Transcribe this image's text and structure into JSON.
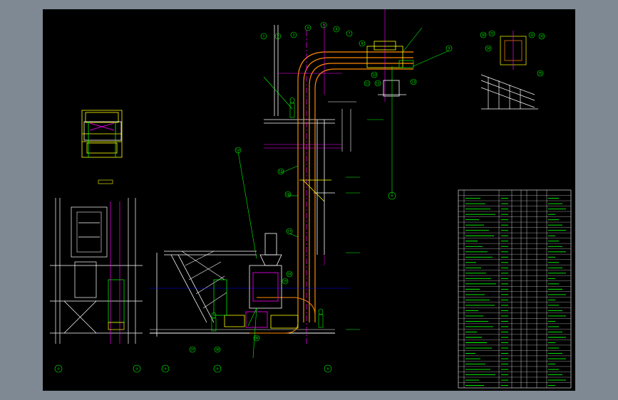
{
  "drawing": {
    "balloons_right_view": [
      "30",
      "31",
      "32",
      "33",
      "34",
      "35",
      "36",
      "37",
      "38"
    ],
    "balloons_main": [
      "1",
      "2",
      "3",
      "4",
      "5",
      "6",
      "7",
      "8",
      "9",
      "10",
      "11",
      "12",
      "13",
      "14",
      "15",
      "16",
      "17",
      "18",
      "19"
    ],
    "axis_bubbles": [
      "①",
      "②",
      "③",
      "④",
      "⑤",
      "⑥"
    ],
    "colors": {
      "background": "#000000",
      "frame": "#ffffff",
      "conveyor": "#ff8800",
      "centerline": "#ff00ff",
      "annotation": "#00ff00",
      "equipment": "#ffff00",
      "structure": "#ffffff"
    }
  },
  "parts_table": {
    "header": [
      "序",
      "名称",
      "数量",
      "",
      "",
      "",
      "备注"
    ],
    "rows_count_visible": 36
  }
}
